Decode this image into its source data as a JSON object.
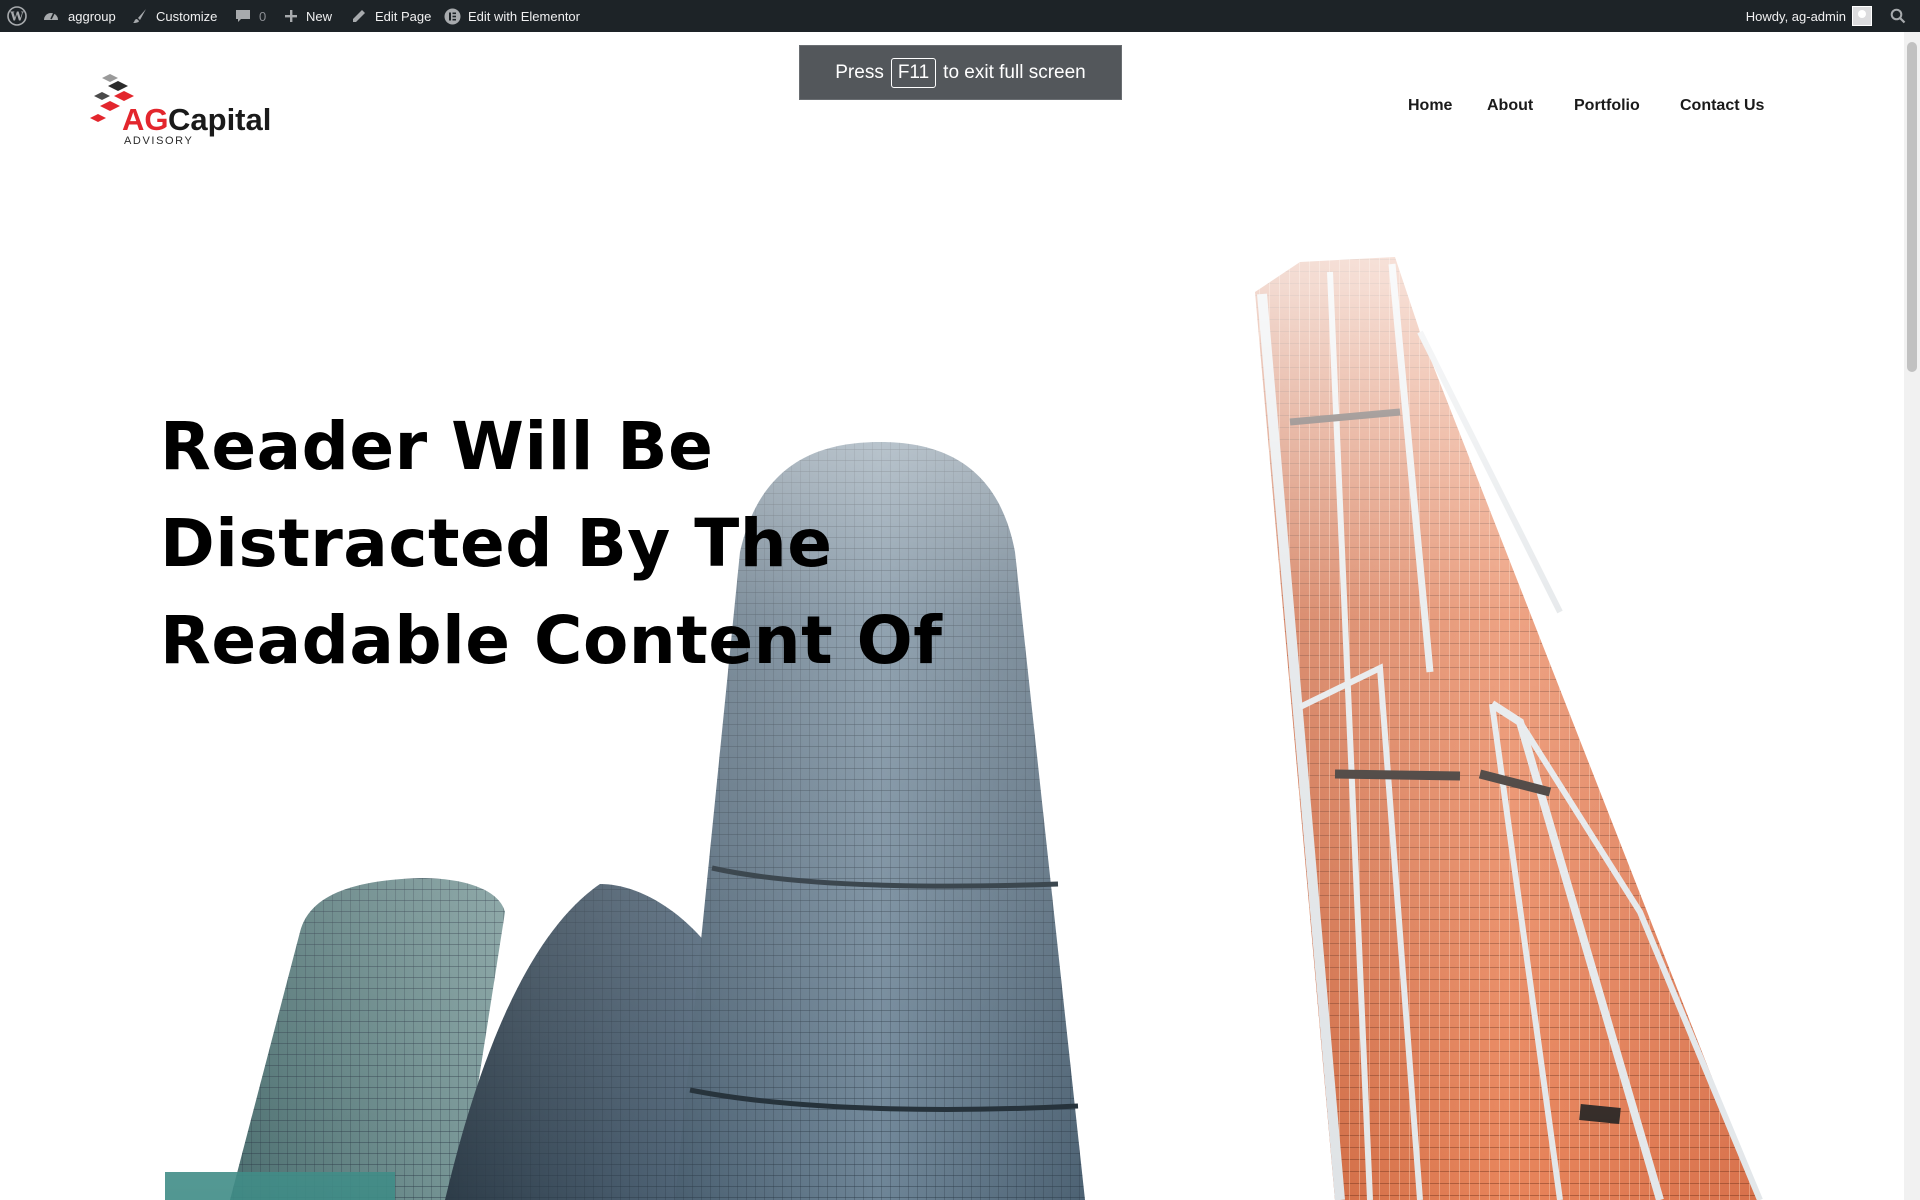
{
  "adminbar": {
    "site_name": "aggroup",
    "customize": "Customize",
    "comments_count": "0",
    "new": "New",
    "edit_page": "Edit Page",
    "edit_elementor": "Edit with Elementor",
    "howdy": "Howdy, ag-admin"
  },
  "toast": {
    "prefix": "Press",
    "key": "F11",
    "suffix": "to exit full screen"
  },
  "logo": {
    "brand_ag": "AG",
    "brand_capital": "Capital",
    "tagline": "ADVISORY"
  },
  "nav": {
    "items": [
      {
        "label": "Home"
      },
      {
        "label": "About"
      },
      {
        "label": "Portfolio"
      },
      {
        "label": "Contact Us"
      }
    ]
  },
  "hero": {
    "lines": [
      "Reader Will Be",
      "Distracted By The",
      "Readable Content Of"
    ]
  },
  "colors": {
    "adminbar_bg": "#1d2327",
    "brand_red": "#e3262d",
    "tower_orange": "#e07a4f",
    "glass_blue": "#5d7487"
  }
}
